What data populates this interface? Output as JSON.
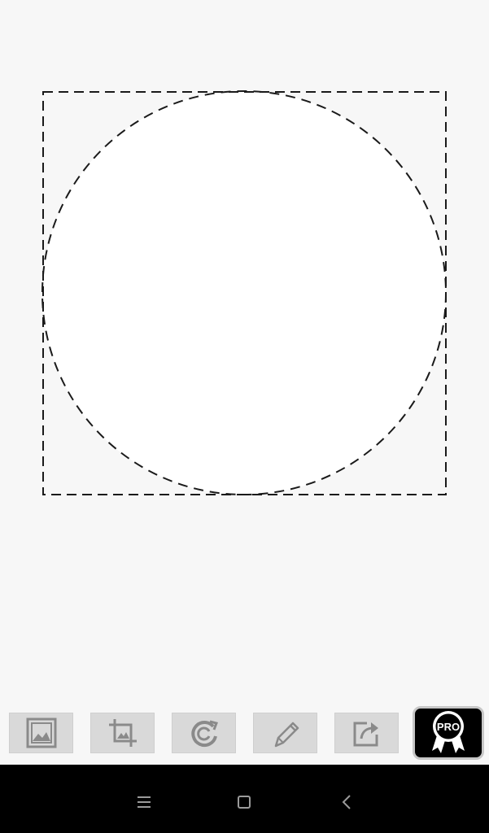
{
  "editor": {
    "crop_shape": "circle"
  },
  "toolbar": {
    "buttons": [
      {
        "id": "gallery",
        "icon": "image-icon"
      },
      {
        "id": "crop",
        "icon": "crop-icon"
      },
      {
        "id": "rotate",
        "icon": "rotate-icon"
      },
      {
        "id": "draw",
        "icon": "pencil-icon"
      },
      {
        "id": "share",
        "icon": "share-icon"
      }
    ],
    "pro_label": "PRO"
  },
  "navbar": {
    "buttons": [
      "menu-icon",
      "home-icon",
      "back-icon"
    ]
  },
  "colors": {
    "background": "#f7f7f7",
    "button_gray": "#d9d9d9",
    "icon_gray": "#8a8a8a",
    "pro_bg": "#000000",
    "navbar": "#000000"
  }
}
